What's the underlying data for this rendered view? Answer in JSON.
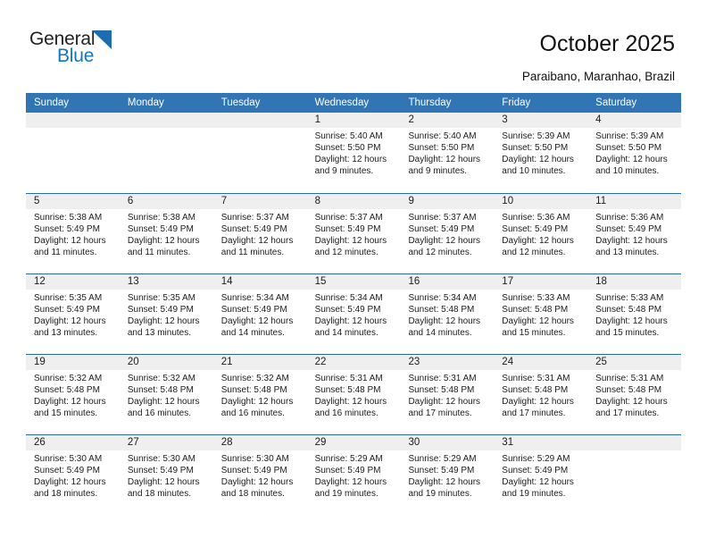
{
  "brand": {
    "name_part1": "General",
    "name_part2": "Blue",
    "accent_color": "#1277be",
    "triangle_color": "#1b6cb0"
  },
  "header": {
    "title": "October 2025",
    "subtitle": "Paraibano, Maranhao, Brazil"
  },
  "calendar": {
    "header_bg": "#3175b4",
    "row_rule_color": "#2c6aa5",
    "day_head_bg": "#efefef",
    "weekdays": [
      "Sunday",
      "Monday",
      "Tuesday",
      "Wednesday",
      "Thursday",
      "Friday",
      "Saturday"
    ],
    "weeks": [
      [
        {
          "day": "",
          "sunrise": "",
          "sunset": "",
          "daylight1": "",
          "daylight2": ""
        },
        {
          "day": "",
          "sunrise": "",
          "sunset": "",
          "daylight1": "",
          "daylight2": ""
        },
        {
          "day": "",
          "sunrise": "",
          "sunset": "",
          "daylight1": "",
          "daylight2": ""
        },
        {
          "day": "1",
          "sunrise": "Sunrise: 5:40 AM",
          "sunset": "Sunset: 5:50 PM",
          "daylight1": "Daylight: 12 hours",
          "daylight2": "and 9 minutes."
        },
        {
          "day": "2",
          "sunrise": "Sunrise: 5:40 AM",
          "sunset": "Sunset: 5:50 PM",
          "daylight1": "Daylight: 12 hours",
          "daylight2": "and 9 minutes."
        },
        {
          "day": "3",
          "sunrise": "Sunrise: 5:39 AM",
          "sunset": "Sunset: 5:50 PM",
          "daylight1": "Daylight: 12 hours",
          "daylight2": "and 10 minutes."
        },
        {
          "day": "4",
          "sunrise": "Sunrise: 5:39 AM",
          "sunset": "Sunset: 5:50 PM",
          "daylight1": "Daylight: 12 hours",
          "daylight2": "and 10 minutes."
        }
      ],
      [
        {
          "day": "5",
          "sunrise": "Sunrise: 5:38 AM",
          "sunset": "Sunset: 5:49 PM",
          "daylight1": "Daylight: 12 hours",
          "daylight2": "and 11 minutes."
        },
        {
          "day": "6",
          "sunrise": "Sunrise: 5:38 AM",
          "sunset": "Sunset: 5:49 PM",
          "daylight1": "Daylight: 12 hours",
          "daylight2": "and 11 minutes."
        },
        {
          "day": "7",
          "sunrise": "Sunrise: 5:37 AM",
          "sunset": "Sunset: 5:49 PM",
          "daylight1": "Daylight: 12 hours",
          "daylight2": "and 11 minutes."
        },
        {
          "day": "8",
          "sunrise": "Sunrise: 5:37 AM",
          "sunset": "Sunset: 5:49 PM",
          "daylight1": "Daylight: 12 hours",
          "daylight2": "and 12 minutes."
        },
        {
          "day": "9",
          "sunrise": "Sunrise: 5:37 AM",
          "sunset": "Sunset: 5:49 PM",
          "daylight1": "Daylight: 12 hours",
          "daylight2": "and 12 minutes."
        },
        {
          "day": "10",
          "sunrise": "Sunrise: 5:36 AM",
          "sunset": "Sunset: 5:49 PM",
          "daylight1": "Daylight: 12 hours",
          "daylight2": "and 12 minutes."
        },
        {
          "day": "11",
          "sunrise": "Sunrise: 5:36 AM",
          "sunset": "Sunset: 5:49 PM",
          "daylight1": "Daylight: 12 hours",
          "daylight2": "and 13 minutes."
        }
      ],
      [
        {
          "day": "12",
          "sunrise": "Sunrise: 5:35 AM",
          "sunset": "Sunset: 5:49 PM",
          "daylight1": "Daylight: 12 hours",
          "daylight2": "and 13 minutes."
        },
        {
          "day": "13",
          "sunrise": "Sunrise: 5:35 AM",
          "sunset": "Sunset: 5:49 PM",
          "daylight1": "Daylight: 12 hours",
          "daylight2": "and 13 minutes."
        },
        {
          "day": "14",
          "sunrise": "Sunrise: 5:34 AM",
          "sunset": "Sunset: 5:49 PM",
          "daylight1": "Daylight: 12 hours",
          "daylight2": "and 14 minutes."
        },
        {
          "day": "15",
          "sunrise": "Sunrise: 5:34 AM",
          "sunset": "Sunset: 5:49 PM",
          "daylight1": "Daylight: 12 hours",
          "daylight2": "and 14 minutes."
        },
        {
          "day": "16",
          "sunrise": "Sunrise: 5:34 AM",
          "sunset": "Sunset: 5:48 PM",
          "daylight1": "Daylight: 12 hours",
          "daylight2": "and 14 minutes."
        },
        {
          "day": "17",
          "sunrise": "Sunrise: 5:33 AM",
          "sunset": "Sunset: 5:48 PM",
          "daylight1": "Daylight: 12 hours",
          "daylight2": "and 15 minutes."
        },
        {
          "day": "18",
          "sunrise": "Sunrise: 5:33 AM",
          "sunset": "Sunset: 5:48 PM",
          "daylight1": "Daylight: 12 hours",
          "daylight2": "and 15 minutes."
        }
      ],
      [
        {
          "day": "19",
          "sunrise": "Sunrise: 5:32 AM",
          "sunset": "Sunset: 5:48 PM",
          "daylight1": "Daylight: 12 hours",
          "daylight2": "and 15 minutes."
        },
        {
          "day": "20",
          "sunrise": "Sunrise: 5:32 AM",
          "sunset": "Sunset: 5:48 PM",
          "daylight1": "Daylight: 12 hours",
          "daylight2": "and 16 minutes."
        },
        {
          "day": "21",
          "sunrise": "Sunrise: 5:32 AM",
          "sunset": "Sunset: 5:48 PM",
          "daylight1": "Daylight: 12 hours",
          "daylight2": "and 16 minutes."
        },
        {
          "day": "22",
          "sunrise": "Sunrise: 5:31 AM",
          "sunset": "Sunset: 5:48 PM",
          "daylight1": "Daylight: 12 hours",
          "daylight2": "and 16 minutes."
        },
        {
          "day": "23",
          "sunrise": "Sunrise: 5:31 AM",
          "sunset": "Sunset: 5:48 PM",
          "daylight1": "Daylight: 12 hours",
          "daylight2": "and 17 minutes."
        },
        {
          "day": "24",
          "sunrise": "Sunrise: 5:31 AM",
          "sunset": "Sunset: 5:48 PM",
          "daylight1": "Daylight: 12 hours",
          "daylight2": "and 17 minutes."
        },
        {
          "day": "25",
          "sunrise": "Sunrise: 5:31 AM",
          "sunset": "Sunset: 5:48 PM",
          "daylight1": "Daylight: 12 hours",
          "daylight2": "and 17 minutes."
        }
      ],
      [
        {
          "day": "26",
          "sunrise": "Sunrise: 5:30 AM",
          "sunset": "Sunset: 5:49 PM",
          "daylight1": "Daylight: 12 hours",
          "daylight2": "and 18 minutes."
        },
        {
          "day": "27",
          "sunrise": "Sunrise: 5:30 AM",
          "sunset": "Sunset: 5:49 PM",
          "daylight1": "Daylight: 12 hours",
          "daylight2": "and 18 minutes."
        },
        {
          "day": "28",
          "sunrise": "Sunrise: 5:30 AM",
          "sunset": "Sunset: 5:49 PM",
          "daylight1": "Daylight: 12 hours",
          "daylight2": "and 18 minutes."
        },
        {
          "day": "29",
          "sunrise": "Sunrise: 5:29 AM",
          "sunset": "Sunset: 5:49 PM",
          "daylight1": "Daylight: 12 hours",
          "daylight2": "and 19 minutes."
        },
        {
          "day": "30",
          "sunrise": "Sunrise: 5:29 AM",
          "sunset": "Sunset: 5:49 PM",
          "daylight1": "Daylight: 12 hours",
          "daylight2": "and 19 minutes."
        },
        {
          "day": "31",
          "sunrise": "Sunrise: 5:29 AM",
          "sunset": "Sunset: 5:49 PM",
          "daylight1": "Daylight: 12 hours",
          "daylight2": "and 19 minutes."
        },
        {
          "day": "",
          "sunrise": "",
          "sunset": "",
          "daylight1": "",
          "daylight2": ""
        }
      ]
    ]
  }
}
